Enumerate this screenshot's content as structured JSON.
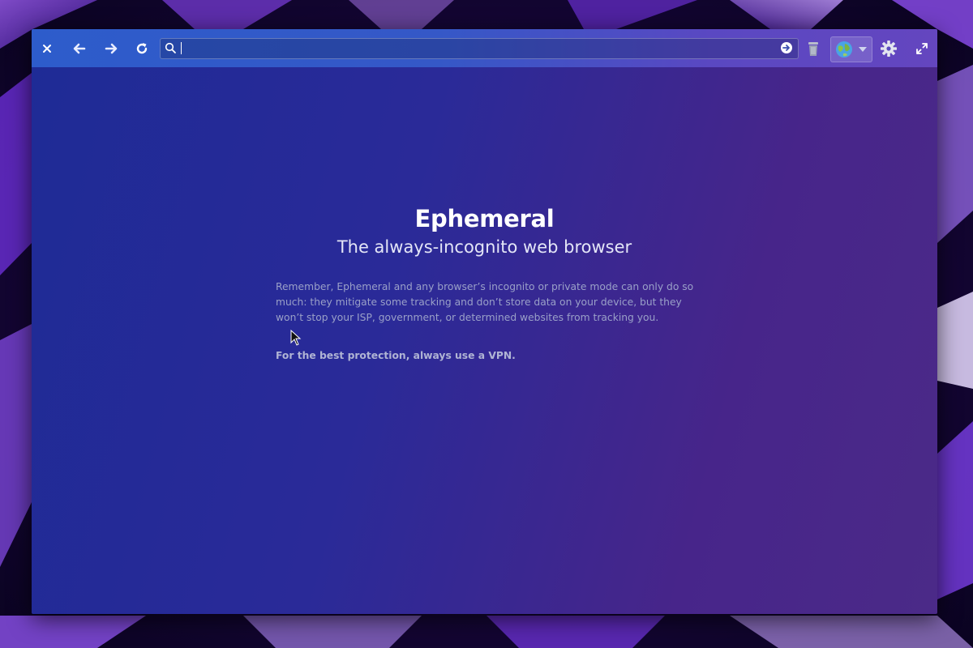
{
  "window": {
    "toolbar": {
      "close_label": "×",
      "back_icon": "arrow-left-icon",
      "forward_icon": "arrow-right-icon",
      "reload_icon": "reload-icon",
      "url_value": "",
      "url_placeholder": "",
      "go_icon": "go-arrow-icon",
      "erase_icon": "trash-icon",
      "browser_icon": "globe-icon",
      "settings_icon": "gear-icon",
      "fullscreen_icon": "fullscreen-icon"
    }
  },
  "welcome": {
    "title": "Ephemeral",
    "subtitle": "The always-incognito web browser",
    "body": "Remember, Ephemeral and any browser’s incognito or private mode can only do so much: they mitigate some tracking and don’t store data on your device, but they won’t stop your ISP, government, or determined websites from tracking you.",
    "vpn_note": "For the best protection, always use a VPN."
  },
  "colors": {
    "titlebar": "#3558c7",
    "content_start": "#1e2b96",
    "content_end": "#4b2a88",
    "title_text": "#ffffff",
    "body_text": "#9aa0c8"
  }
}
